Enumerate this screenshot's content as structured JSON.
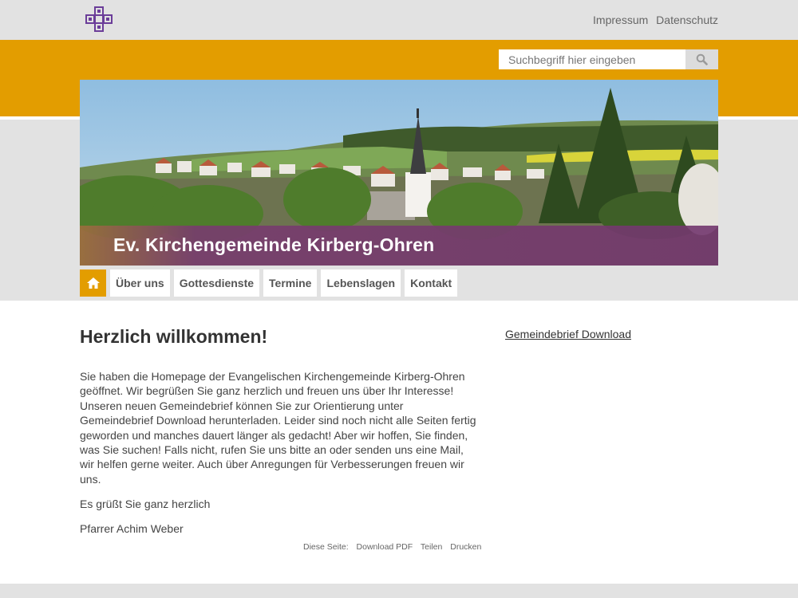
{
  "header": {
    "links": [
      "Impressum",
      "Datenschutz"
    ]
  },
  "search": {
    "placeholder": "Suchbegriff hier eingeben"
  },
  "hero": {
    "title": "Ev. Kirchengemeinde Kirberg-Ohren"
  },
  "nav": {
    "items": [
      "Über uns",
      "Gottesdienste",
      "Termine",
      "Lebenslagen",
      "Kontakt"
    ]
  },
  "content": {
    "heading": "Herzlich willkommen!",
    "paragraphs": [
      "Sie haben die Homepage der Evangelischen Kirchengemeinde Kirberg-Ohren geöffnet. Wir begrüßen Sie ganz herzlich und freuen uns über Ihr Interesse! Unseren neuen Gemeindebrief können Sie zur Orientierung unter Gemeindebrief Download herunterladen. Leider sind noch nicht alle Seiten fertig geworden und manches dauert länger als gedacht! Aber wir hoffen, Sie finden, was Sie suchen! Falls nicht, rufen Sie uns bitte an oder senden uns eine Mail, wir helfen gerne weiter. Auch über Anregungen für Verbesserungen freuen wir uns.",
      "Es grüßt Sie ganz herzlich",
      "Pfarrer Achim Weber"
    ]
  },
  "sidebar": {
    "link": "Gemeindebrief Download"
  },
  "pagetools": {
    "label": "Diese Seite:",
    "items": [
      "Download PDF",
      "Teilen",
      "Drucken"
    ]
  },
  "colors": {
    "accent": "#e39d00",
    "title_bar": "#73376e",
    "logo": "#6b3d99"
  },
  "icons": {
    "logo": "cross-logo-icon",
    "search": "search-icon",
    "home": "home-icon"
  }
}
